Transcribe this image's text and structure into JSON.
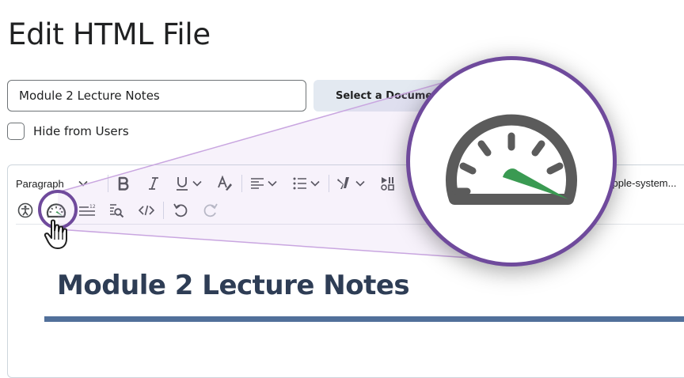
{
  "page": {
    "title": "Edit HTML File"
  },
  "form": {
    "title_value": "Module 2 Lecture Notes",
    "select_document_label": "Select a Document",
    "hide_label": "Hide from Users"
  },
  "toolbar": {
    "paragraph_label": "Paragraph",
    "font_label": "-apple-system..."
  },
  "content": {
    "heading": "Module 2 Lecture Notes"
  },
  "icons": {
    "row1": [
      "chevron-down-icon",
      "bold-icon",
      "italic-icon",
      "underline-icon",
      "text-color-icon",
      "align-left-icon",
      "bullet-list-icon",
      "insert-stuff-icon",
      "media-icon"
    ],
    "row2": [
      "accessibility-icon",
      "speedometer-icon",
      "word-count-icon",
      "find-replace-icon",
      "source-code-icon",
      "undo-icon",
      "redo-icon"
    ],
    "callout": [
      "hand-cursor-icon",
      "speedometer-icon"
    ]
  },
  "colors": {
    "highlight_ring": "#6f4a9c",
    "gauge_needle": "#3a9a52",
    "heading": "#2e3d55",
    "heading_rule": "#51709a"
  }
}
